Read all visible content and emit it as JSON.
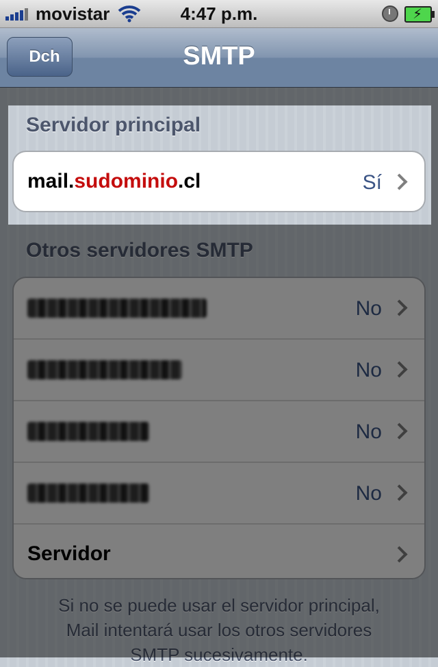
{
  "status": {
    "carrier": "movistar",
    "time": "4:47 p.m."
  },
  "nav": {
    "back_label": "Dch",
    "title": "SMTP"
  },
  "primary": {
    "header": "Servidor principal",
    "server": {
      "prefix": "mail.",
      "domain": "sudominio",
      "suffix": ".cl",
      "status": "Sí"
    }
  },
  "others": {
    "header": "Otros servidores SMTP",
    "items": [
      {
        "status": "No"
      },
      {
        "status": "No"
      },
      {
        "status": "No"
      },
      {
        "status": "No"
      }
    ],
    "add_label": "Servidor"
  },
  "footer": {
    "lines": [
      "Si no se puede usar el servidor principal,",
      "Mail intentará usar los otros servidores",
      "SMTP sucesivamente."
    ]
  },
  "colors": {
    "accent_red": "#c40d0d",
    "value_blue": "#3b5485",
    "battery_green": "#4ed64c"
  }
}
